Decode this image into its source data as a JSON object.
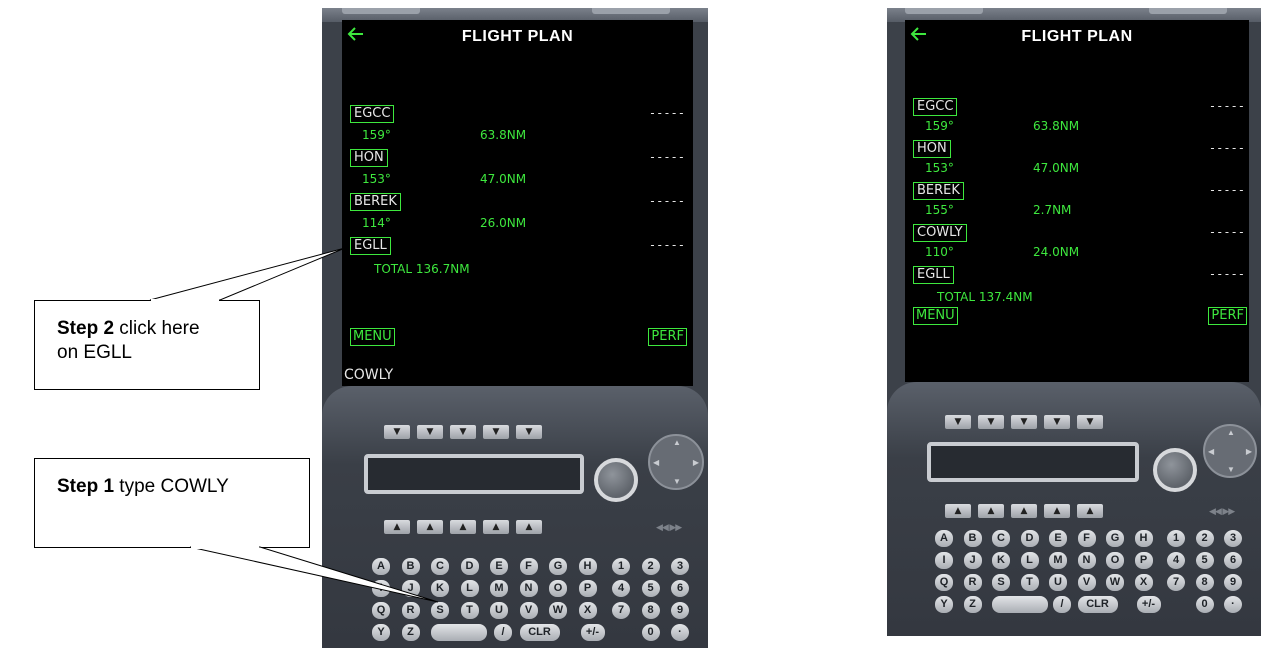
{
  "left": {
    "title": "FLIGHT PLAN",
    "waypoints": [
      {
        "id": "EGCC",
        "dashes": "-----",
        "course": "159°",
        "distance": "63.8NM"
      },
      {
        "id": "HON",
        "dashes": "-----",
        "course": "153°",
        "distance": "47.0NM"
      },
      {
        "id": "BEREK",
        "dashes": "-----",
        "course": "114°",
        "distance": "26.0NM"
      },
      {
        "id": "EGLL",
        "dashes": "-----"
      }
    ],
    "total": "TOTAL  136.7NM",
    "menu": "MENU",
    "perf": "PERF",
    "scratchpad": "COWLY"
  },
  "right": {
    "title": "FLIGHT PLAN",
    "waypoints": [
      {
        "id": "EGCC",
        "dashes": "-----",
        "course": "159°",
        "distance": "63.8NM"
      },
      {
        "id": "HON",
        "dashes": "-----",
        "course": "153°",
        "distance": "47.0NM"
      },
      {
        "id": "BEREK",
        "dashes": "-----",
        "course": "155°",
        "distance": "2.7NM"
      },
      {
        "id": "COWLY",
        "dashes": "-----",
        "course": "110°",
        "distance": "24.0NM"
      },
      {
        "id": "EGLL",
        "dashes": "-----"
      }
    ],
    "total": "TOTAL  137.4NM",
    "menu": "MENU",
    "perf": "PERF"
  },
  "keypad": {
    "down_arrow": "▼",
    "up_arrow": "▲",
    "rows": [
      [
        "A",
        "B",
        "C",
        "D",
        "E",
        "F",
        "G",
        "H",
        "1",
        "2",
        "3"
      ],
      [
        "I",
        "J",
        "K",
        "L",
        "M",
        "N",
        "O",
        "P",
        "4",
        "5",
        "6"
      ],
      [
        "Q",
        "R",
        "S",
        "T",
        "U",
        "V",
        "W",
        "X",
        "7",
        "8",
        "9"
      ],
      [
        "Y",
        "Z",
        "",
        "/",
        "CLR",
        "+/-",
        "0",
        "·"
      ]
    ]
  },
  "callouts": {
    "step2_bold": "Step 2",
    "step2_rest": " click here",
    "step2_line2": "on EGLL",
    "step1_bold": "Step 1",
    "step1_rest": " type COWLY"
  },
  "colors": {
    "fms_green": "#3ee83e",
    "screen_bg": "#000000",
    "device_bg": "#3c4149"
  },
  "icons": {
    "back": "left-arrow-icon"
  }
}
